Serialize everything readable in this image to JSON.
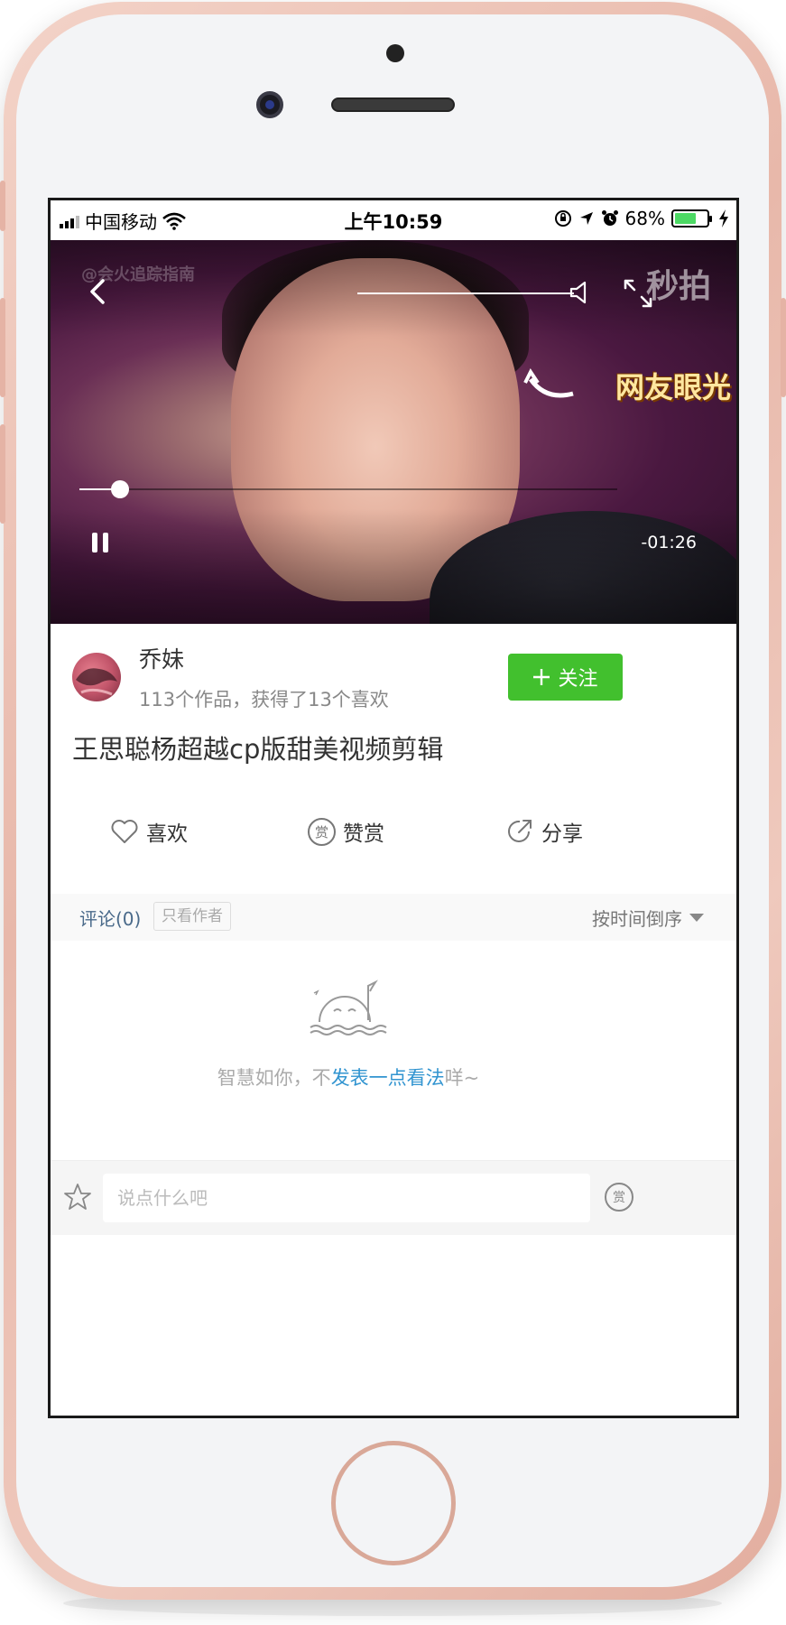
{
  "status_bar": {
    "carrier": "中国移动",
    "time": "上午10:59",
    "battery_percent": "68%",
    "battery_level": 0.68,
    "icons": [
      "signal-icon",
      "wifi-icon",
      "orientation-lock-icon",
      "location-icon",
      "alarm-icon",
      "battery-icon",
      "charging-icon"
    ]
  },
  "video": {
    "watermark_left": "@会火追踪指南",
    "watermark_right": "秒拍",
    "overlay_caption": "网友眼光",
    "time_remaining": "-01:26",
    "progress": 0.075,
    "volume": 1.0,
    "state": "playing"
  },
  "author": {
    "name": "乔妹",
    "stats": "113个作品，获得了13个喜欢",
    "follow_label": "关注",
    "follow_color": "#42c02e"
  },
  "post": {
    "title": "王思聪杨超越cp版甜美视频剪辑"
  },
  "actions": {
    "like_label": "喜欢",
    "reward_label": "赞赏",
    "reward_icon_text": "赏",
    "share_label": "分享"
  },
  "comments": {
    "count_label": "评论(0)",
    "author_only_label": "只看作者",
    "sort_label": "按时间倒序",
    "empty_prefix": "智慧如你，不",
    "empty_link": "发表一点看法",
    "empty_suffix": "咩~",
    "link_color": "#3194d0"
  },
  "bottom_bar": {
    "input_placeholder": "说点什么吧",
    "reward_icon_text": "赏"
  }
}
